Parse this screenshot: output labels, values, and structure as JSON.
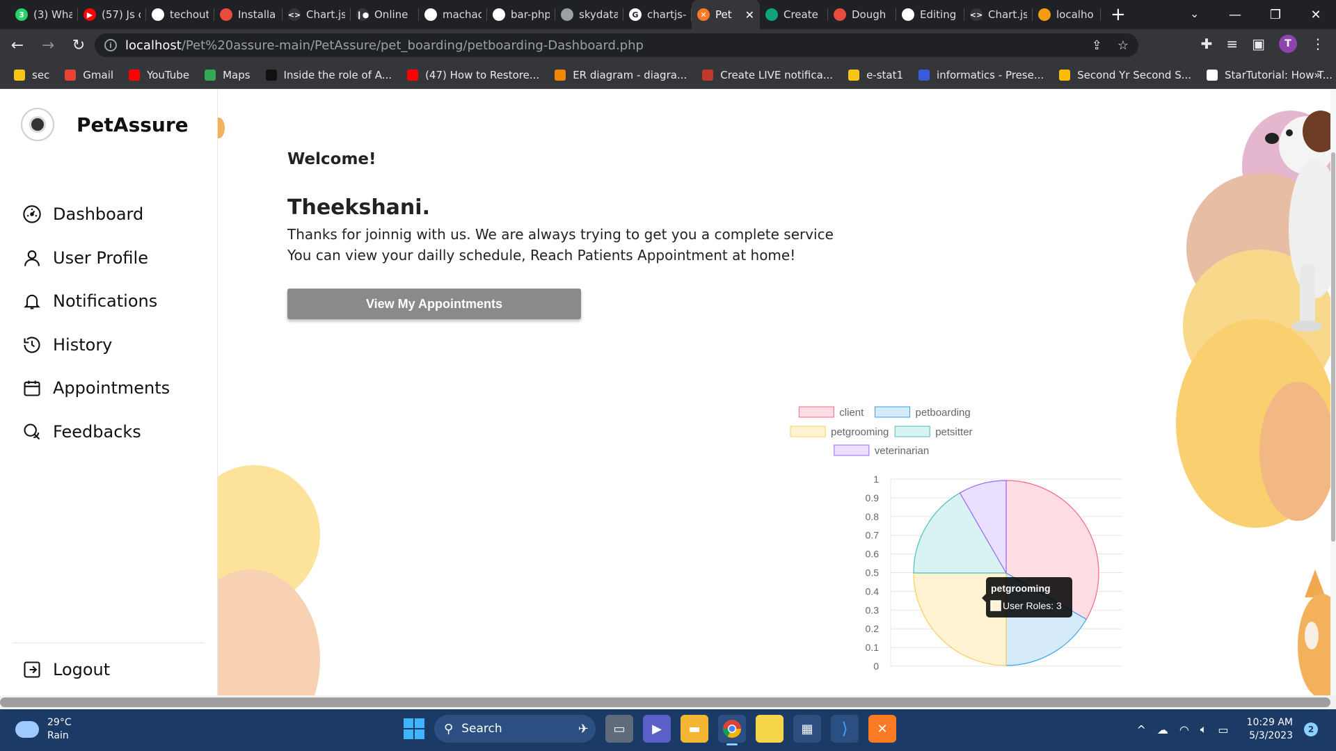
{
  "browser": {
    "tabs": [
      {
        "title": "(3) Wha",
        "icon": "whatsapp-icon",
        "color": "#25d366",
        "glyph": "3"
      },
      {
        "title": "(57) Js c",
        "icon": "youtube-icon",
        "color": "#ff0000",
        "glyph": "▶"
      },
      {
        "title": "techout",
        "icon": "github-icon",
        "color": "#ffffff",
        "glyph": ""
      },
      {
        "title": "Installa",
        "icon": "laravel-icon",
        "color": "#e74c3c",
        "glyph": ""
      },
      {
        "title": "Chart.js",
        "icon": "code-icon",
        "color": "#35363a",
        "glyph": "<>"
      },
      {
        "title": "Online",
        "icon": "online-icon",
        "color": "#35363a",
        "glyph": "❙●"
      },
      {
        "title": "machac",
        "icon": "github-icon",
        "color": "#ffffff",
        "glyph": ""
      },
      {
        "title": "bar-php",
        "icon": "github-icon",
        "color": "#ffffff",
        "glyph": ""
      },
      {
        "title": "skydata",
        "icon": "globe-icon",
        "color": "#9aa0a6",
        "glyph": ""
      },
      {
        "title": "chartjs-",
        "icon": "google-icon",
        "color": "#ffffff",
        "glyph": "G"
      },
      {
        "title": "Pet",
        "icon": "xampp-icon",
        "color": "#fb7a24",
        "glyph": "✕",
        "active": true
      },
      {
        "title": "Create",
        "icon": "chatgpt-icon",
        "color": "#10a37f",
        "glyph": ""
      },
      {
        "title": "Dough",
        "icon": "laravel-icon",
        "color": "#e74c3c",
        "glyph": ""
      },
      {
        "title": "Editing",
        "icon": "github-icon",
        "color": "#ffffff",
        "glyph": ""
      },
      {
        "title": "Chart.js",
        "icon": "code-icon",
        "color": "#35363a",
        "glyph": "<>"
      },
      {
        "title": "localho",
        "icon": "phpmyadmin-icon",
        "color": "#f39c12",
        "glyph": ""
      }
    ],
    "url_host": "localhost",
    "url_path": "/Pet%20assure-main/PetAssure/pet_boarding/petboarding-Dashboard.php",
    "profile_initial": "T",
    "bookmarks": [
      {
        "label": "sec",
        "color": "#f5c518"
      },
      {
        "label": "Gmail",
        "color": "#ea4335"
      },
      {
        "label": "YouTube",
        "color": "#ff0000"
      },
      {
        "label": "Maps",
        "color": "#34a853"
      },
      {
        "label": "Inside the role of A...",
        "color": "#111111"
      },
      {
        "label": "(47) How to Restore...",
        "color": "#ff0000"
      },
      {
        "label": "ER diagram - diagra...",
        "color": "#f08705"
      },
      {
        "label": "Create LIVE notifica...",
        "color": "#c0392b"
      },
      {
        "label": "e-stat1",
        "color": "#f5c518"
      },
      {
        "label": "informatics - Prese...",
        "color": "#3b5bdb"
      },
      {
        "label": "Second Yr Second S...",
        "color": "#fbbc04"
      },
      {
        "label": "StarTutorial: How T...",
        "color": "#ffffff"
      }
    ],
    "bookmarks_more": "»"
  },
  "sidebar": {
    "brand": "PetAssure",
    "items": [
      {
        "label": "Dashboard",
        "icon": "dashboard-gauge-icon"
      },
      {
        "label": "User Profile",
        "icon": "user-icon"
      },
      {
        "label": "Notifications",
        "icon": "bell-icon"
      },
      {
        "label": "History",
        "icon": "history-icon"
      },
      {
        "label": "Appointments",
        "icon": "calendar-icon"
      },
      {
        "label": "Feedbacks",
        "icon": "chat-bubble-icon"
      }
    ],
    "logout": "Logout"
  },
  "main": {
    "welcome": "Welcome!",
    "username": "Theekshani.",
    "message_line1": "Thanks for joinnig with us. We are always trying to get you a complete service",
    "message_line2": "You can view your dailly schedule, Reach Patients Appointment at home!",
    "button": "View My Appointments"
  },
  "chart_data": {
    "type": "pie",
    "categories": [
      "client",
      "petboarding",
      "petgrooming",
      "petsitter",
      "veterinarian"
    ],
    "values": [
      4,
      2,
      3,
      2,
      1
    ],
    "series_label": "User Roles",
    "colors_fill": [
      "#ffdde4",
      "#d6ebfa",
      "#fff3d4",
      "#d9f2f2",
      "#ebe0ff"
    ],
    "colors_border": [
      "#ff6384",
      "#36a2eb",
      "#ffcd56",
      "#4bc0c0",
      "#9966ff"
    ],
    "y_ticks": [
      "1",
      "0.9",
      "0.8",
      "0.7",
      "0.6",
      "0.5",
      "0.4",
      "0.3",
      "0.2",
      "0.1",
      "0"
    ],
    "legend_position": "top",
    "tooltip": {
      "title": "petgrooming",
      "body": "User Roles: 3",
      "color": "#ffcd56"
    }
  },
  "taskbar": {
    "temperature": "29°C",
    "weather": "Rain",
    "search": "Search",
    "time": "10:29 AM",
    "date": "5/3/2023",
    "notifications": "2"
  }
}
